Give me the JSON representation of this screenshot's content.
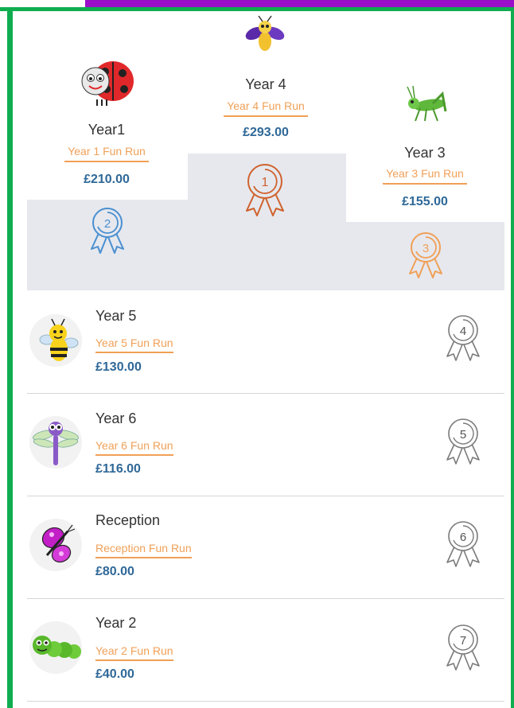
{
  "colors": {
    "accent_purple": "#9a10c9",
    "frame_green": "#0fad4f",
    "link_orange": "#f0a057",
    "amount_blue": "#2f6898",
    "medal_gold": "#d0622d",
    "medal_silver": "#4a8fd0",
    "medal_bronze": "#f0a057",
    "medal_grey": "#7a7a7a"
  },
  "podium": [
    {
      "rank": "1",
      "name": "Year 4",
      "link": "Year 4 Fun Run",
      "amount": "£293.00",
      "icon": "firefly-icon"
    },
    {
      "rank": "2",
      "name": "Year1",
      "link": "Year 1 Fun Run",
      "amount": "£210.00",
      "icon": "ladybird-icon"
    },
    {
      "rank": "3",
      "name": "Year 3",
      "link": "Year 3 Fun Run",
      "amount": "£155.00",
      "icon": "grasshopper-icon"
    }
  ],
  "rows": [
    {
      "rank": "4",
      "name": "Year 5",
      "link": "Year 5 Fun Run",
      "amount": "£130.00",
      "icon": "bee-icon"
    },
    {
      "rank": "5",
      "name": "Year 6",
      "link": "Year 6 Fun Run",
      "amount": "£116.00",
      "icon": "dragonfly-icon"
    },
    {
      "rank": "6",
      "name": "Reception",
      "link": "Reception Fun Run",
      "amount": "£80.00",
      "icon": "butterfly-icon"
    },
    {
      "rank": "7",
      "name": "Year 2",
      "link": "Year 2 Fun Run",
      "amount": "£40.00",
      "icon": "caterpillar-icon"
    }
  ]
}
